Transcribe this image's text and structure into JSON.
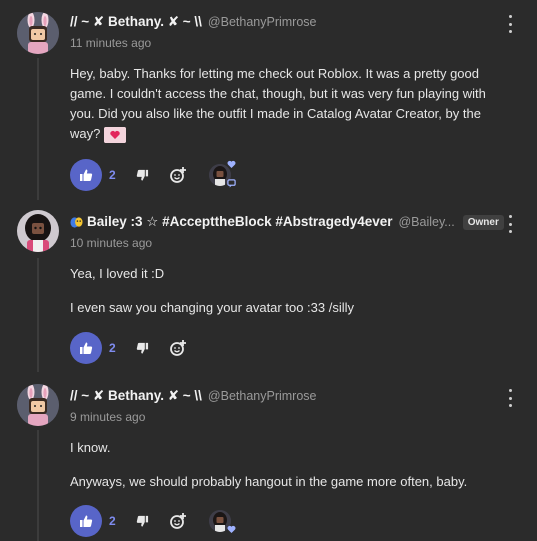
{
  "posts": [
    {
      "author": "// ~ ✘ Bethany. ✘ ~ \\\\",
      "handle": "@BethanyPrimrose",
      "time": "11 minutes ago",
      "paragraphs": [
        "Hey, baby. Thanks for letting me check out Roblox. It was a pretty good game. I couldn't access the chat, though, but it was very fun playing with you. Did you also like the outfit I made in Catalog Avatar Creator, by the way?"
      ],
      "likes": "2"
    },
    {
      "author": "Bailey :3 ☆ #AccepttheBlock #Abstragedy4ever",
      "handle": "@Bailey...",
      "badge": "Owner",
      "time": "10 minutes ago",
      "paragraphs": [
        "Yea, I loved it :D",
        "I even saw you changing your avatar too :33 /silly"
      ],
      "likes": "2"
    },
    {
      "author": "// ~ ✘ Bethany. ✘ ~ \\\\",
      "handle": "@BethanyPrimrose",
      "time": "9 minutes ago",
      "paragraphs": [
        "I know.",
        "Anyways, we should probably hangout in the game more often, baby."
      ],
      "likes": "2"
    }
  ],
  "colors": {
    "background": "#2b2b2b",
    "like_button": "#5865c8",
    "like_count": "#7f8cf0"
  }
}
